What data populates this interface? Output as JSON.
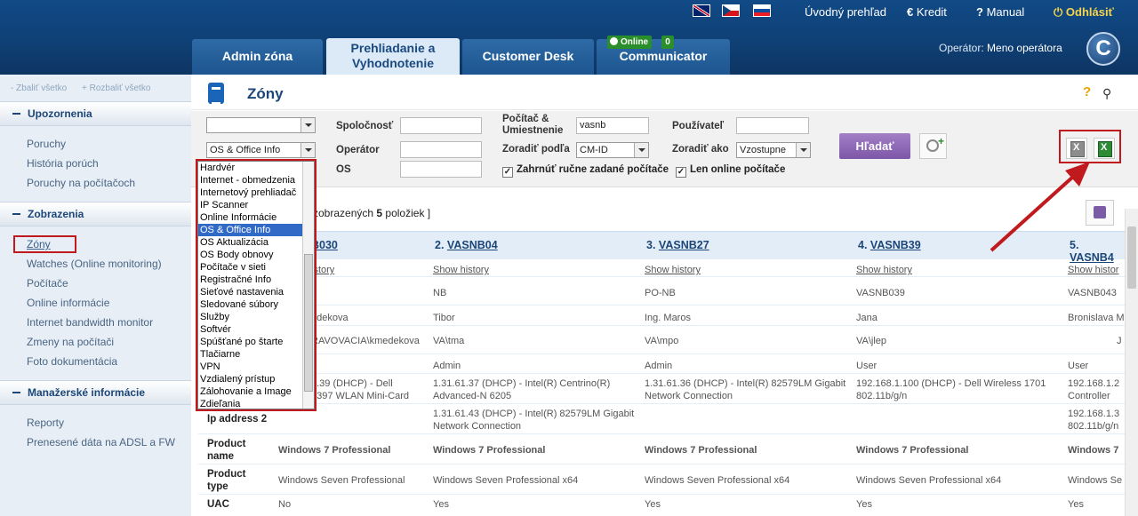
{
  "header": {
    "flags": [
      "uk-flag-icon",
      "cz-flag-icon",
      "sk-flag-icon"
    ],
    "home": "Úvodný prehľad",
    "credit": "Kredit",
    "manual": "Manual",
    "logout": "Odhlásiť",
    "operator_label": "Operátor:",
    "operator_name": "Meno operátora",
    "logo": "C"
  },
  "tabs": {
    "admin": "Admin zóna",
    "review_line1": "Prehliadanie a",
    "review_line2": "Vyhodnotenie",
    "customer": "Customer Desk",
    "comm": "Communicator",
    "online_badge": "Online",
    "online_count": "0"
  },
  "sidebar": {
    "collapse_all": "- Zbaliť všetko",
    "expand_all": "+ Rozbaliť všetko",
    "sections": [
      {
        "title": "Upozornenia",
        "items": [
          "Poruchy",
          "História porúch",
          "Poruchy na počítačoch"
        ]
      },
      {
        "title": "Zobrazenia",
        "items": [
          "Zóny",
          "Watches (Online monitoring)",
          "Počítače",
          "Online informácie",
          "Internet bandwidth monitor",
          "Zmeny na počítači",
          "Foto dokumentácia"
        ]
      },
      {
        "title": "Manažerské informácie",
        "items": [
          "Reporty",
          "Prenesené dáta na ADSL a FW"
        ]
      }
    ]
  },
  "page": {
    "title": "Zóny",
    "help": "?"
  },
  "filter": {
    "select1_value": "",
    "select2_value": "OS & Office Info",
    "company_label": "Spoločnosť",
    "operator_label": "Operátor",
    "os_label": "OS",
    "computer_label_line1": "Počítač &",
    "computer_label_line2": "Umiestnenie",
    "computer_value": "vasnb",
    "sort_by_label": "Zoradiť podľa",
    "sort_by_value": "CM-ID",
    "include_manual": "Zahrnúť ručne zadané počítače",
    "user_label": "Používateľ",
    "sort_as_label": "Zoradiť ako",
    "sort_as_value": "Vzostupne",
    "online_only": "Len online počítače",
    "search_button": "Hľadať"
  },
  "info_line_prefix": "zobrazených",
  "info_line_count": "5",
  "info_line_suffix": "položiek ]",
  "dropdown": {
    "items": [
      "Hardvér",
      "Internet - obmedzenia",
      "Internetový prehliadač",
      "IP Scanner",
      "Online Informácie",
      "OS & Office Info",
      "OS Aktualizácia",
      "OS Body obnovy",
      "Počítače v sieti",
      "Registračné Info",
      "Sieťové nastavenia",
      "Sledované súbory",
      "Služby",
      "Softvér",
      "Spúšťané po štarte",
      "Tlačiarne",
      "VPN",
      "Vzdialený prístup",
      "Zálohovanie a Image",
      "Zdieľania"
    ],
    "selected": "OS & Office Info"
  },
  "grid": {
    "columns": [
      {
        "num": "",
        "name": "B030"
      },
      {
        "num": "2.",
        "name": "VASNB04"
      },
      {
        "num": "3.",
        "name": "VASNB27"
      },
      {
        "num": "4.",
        "name": "VASNB39"
      },
      {
        "num": "5.",
        "name": "VASNB4"
      }
    ],
    "history": [
      "istory",
      "Show history",
      "Show history",
      "Show history",
      "Show histor"
    ],
    "row_name": [
      "",
      "NB",
      "PO-NB",
      "VASNB039",
      "VASNB043"
    ],
    "row_user": [
      "edekova",
      "Tibor",
      "Ing. Maros",
      "Jana",
      "Bronislava M"
    ],
    "row_account": [
      "RAVOVACIA\\kmedekova",
      "VA\\tma",
      "VA\\mpo",
      "VA\\jlep",
      "J"
    ],
    "row_rights": [
      "",
      "Admin",
      "Admin",
      "User",
      "User"
    ],
    "row_ip1": [
      [
        "1.39 (DHCP) - Dell",
        "1397 WLAN Mini-Card"
      ],
      [
        "1.31.61.37 (DHCP) - Intel(R) Centrino(R)",
        "Advanced-N 6205"
      ],
      [
        "1.31.61.36 (DHCP) - Intel(R) 82579LM Gigabit",
        "Network Connection"
      ],
      [
        "192.168.1.100 (DHCP) - Dell Wireless 1701",
        "802.11b/g/n"
      ],
      [
        "192.168.1.2",
        "Controller"
      ]
    ],
    "ip2_label": "Ip address 2",
    "row_ip2": [
      [
        "",
        ""
      ],
      [
        "1.31.61.43 (DHCP) - Intel(R) 82579LM Gigabit",
        "Network Connection"
      ],
      [
        "",
        ""
      ],
      [
        "",
        ""
      ],
      [
        "192.168.1.3",
        "802.11b/g/n"
      ]
    ],
    "product_name_label_1": "Product",
    "product_name_label_2": "name",
    "product_name": [
      "Windows 7 Professional",
      "Windows 7 Professional",
      "Windows 7 Professional",
      "Windows 7 Professional",
      "Windows 7"
    ],
    "product_type_label_1": "Product",
    "product_type_label_2": "type",
    "product_type": [
      "Windows Seven Professional",
      "Windows Seven Professional x64",
      "Windows Seven Professional x64",
      "Windows Seven Professional x64",
      "Windows Se"
    ],
    "uac_label": "UAC",
    "uac": [
      "No",
      "Yes",
      "Yes",
      "Yes",
      "Yes"
    ]
  },
  "colors": {
    "header_bg": "#0f3f74",
    "accent_red": "#c0191e",
    "search_button": "#8a63b3",
    "selected_item": "#3169c6"
  }
}
